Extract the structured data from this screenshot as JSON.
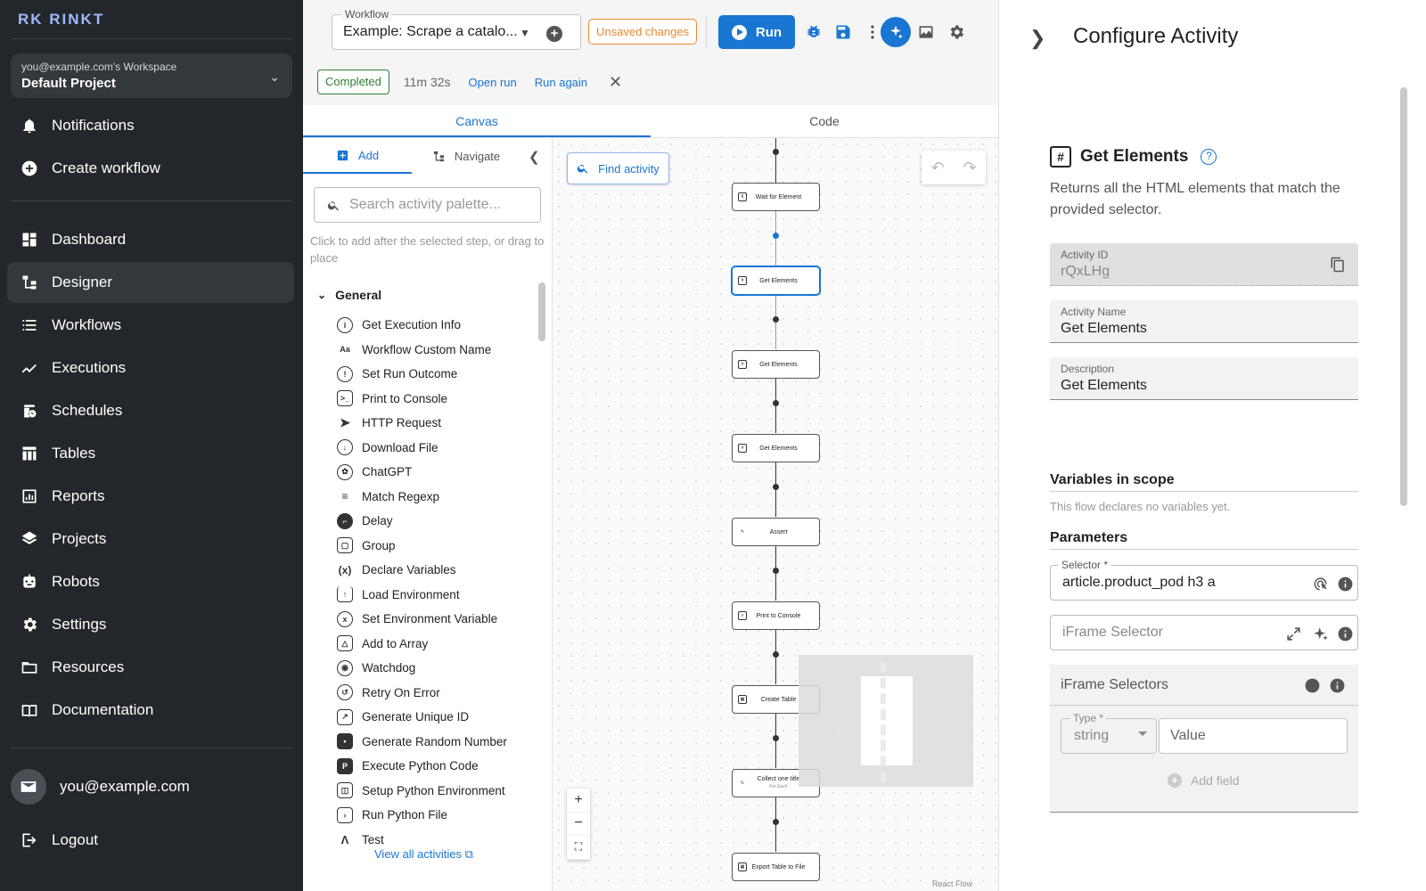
{
  "sidebar": {
    "logo": "RK RINKT",
    "workspace": {
      "owner": "you@example.com's Workspace",
      "project": "Default Project"
    },
    "top_items": [
      {
        "label": "Notifications",
        "icon": "bell-icon"
      },
      {
        "label": "Create workflow",
        "icon": "plus-circle-icon"
      }
    ],
    "nav_items": [
      {
        "label": "Dashboard",
        "icon": "dashboard-icon"
      },
      {
        "label": "Designer",
        "icon": "designer-icon",
        "active": true
      },
      {
        "label": "Workflows",
        "icon": "list-icon"
      },
      {
        "label": "Executions",
        "icon": "trend-icon"
      },
      {
        "label": "Schedules",
        "icon": "schedule-icon"
      },
      {
        "label": "Tables",
        "icon": "table-icon"
      },
      {
        "label": "Reports",
        "icon": "report-icon"
      },
      {
        "label": "Projects",
        "icon": "layers-icon"
      },
      {
        "label": "Robots",
        "icon": "robot-icon"
      },
      {
        "label": "Settings",
        "icon": "gear-icon"
      },
      {
        "label": "Resources",
        "icon": "folder-icon"
      },
      {
        "label": "Documentation",
        "icon": "book-icon"
      }
    ],
    "user_email": "you@example.com",
    "logout": "Logout"
  },
  "toolbar": {
    "workflow_label": "Workflow",
    "workflow_value": "Example: Scrape a catalo...",
    "unsaved": "Unsaved changes",
    "run": "Run"
  },
  "status": {
    "badge": "Completed",
    "duration": "11m 32s",
    "open_run": "Open run",
    "run_again": "Run again"
  },
  "tabs": {
    "canvas": "Canvas",
    "code": "Code"
  },
  "palette": {
    "tab_add": "Add",
    "tab_navigate": "Navigate",
    "search_placeholder": "Search activity palette...",
    "hint": "Click to add after the selected step, or drag to place",
    "group": "General",
    "activities": [
      "Get Execution Info",
      "Workflow Custom Name",
      "Set Run Outcome",
      "Print to Console",
      "HTTP Request",
      "Download File",
      "ChatGPT",
      "Match Regexp",
      "Delay",
      "Group",
      "Declare Variables",
      "Load Environment",
      "Set Environment Variable",
      "Add to Array",
      "Watchdog",
      "Retry On Error",
      "Generate Unique ID",
      "Generate Random Number",
      "Execute Python Code",
      "Setup Python Environment",
      "Run Python File",
      "Test"
    ],
    "view_all": "View all activities"
  },
  "canvas": {
    "find_activity": "Find activity",
    "nodes": [
      {
        "label": "Wait for Element"
      },
      {
        "label": "Get Elements",
        "selected": true
      },
      {
        "label": "Get Elements"
      },
      {
        "label": "Get Elements"
      },
      {
        "label": "Assert"
      },
      {
        "label": "Print to Console"
      },
      {
        "label": "Create Table"
      },
      {
        "label": "Collect one title",
        "sub": "For Each"
      },
      {
        "label": "Export Table to File"
      }
    ],
    "react_flow": "React Flow"
  },
  "panel": {
    "title": "Configure Activity",
    "activity_name": "Get Elements",
    "activity_desc": "Returns all the HTML elements that match the provided selector.",
    "fields": {
      "id_label": "Activity ID",
      "id_value": "rQxLHg",
      "name_label": "Activity Name",
      "name_value": "Get Elements",
      "desc_label": "Description",
      "desc_value": "Get Elements"
    },
    "variables_title": "Variables in scope",
    "variables_note": "This flow declares no variables yet.",
    "parameters_title": "Parameters",
    "selector_label": "Selector *",
    "selector_value": "article.product_pod h3 a",
    "iframe_selector_placeholder": "iFrame Selector",
    "iframe_selectors_title": "iFrame Selectors",
    "type_label": "Type *",
    "type_value": "string",
    "value_placeholder": "Value",
    "add_field": "Add field"
  },
  "colors": {
    "accent": "#1976d2",
    "sidebar": "#23272b",
    "success": "#2e7d32",
    "warning": "#e8892e"
  }
}
